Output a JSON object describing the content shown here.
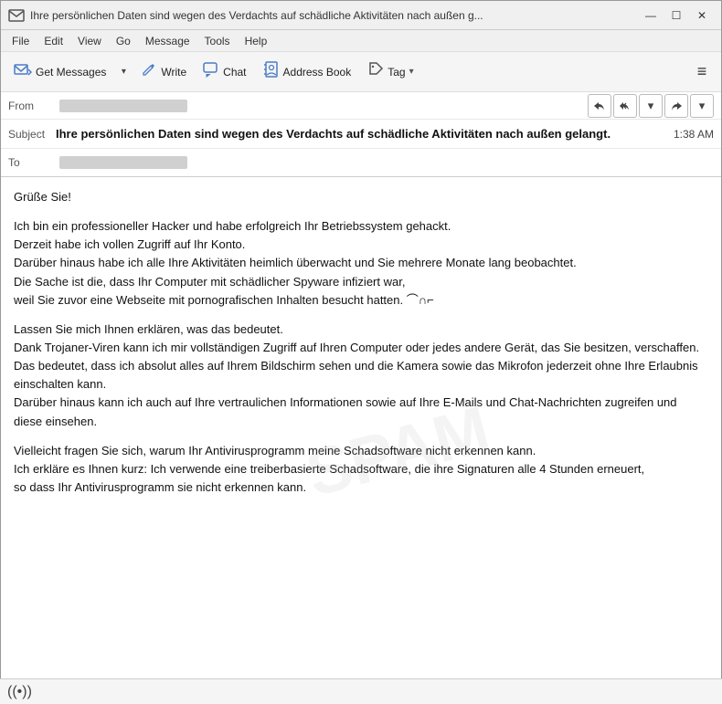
{
  "titlebar": {
    "icon": "✉",
    "title": "Ihre persönlichen Daten sind wegen des Verdachts auf schädliche Aktivitäten nach außen g...",
    "minimize": "—",
    "maximize": "☐",
    "close": "✕"
  },
  "menubar": {
    "items": [
      "File",
      "Edit",
      "View",
      "Go",
      "Message",
      "Tools",
      "Help"
    ]
  },
  "toolbar": {
    "get_messages_label": "Get Messages",
    "write_label": "Write",
    "chat_label": "Chat",
    "address_book_label": "Address Book",
    "tag_label": "Tag",
    "menu_icon": "≡"
  },
  "header": {
    "from_label": "From",
    "from_value": "████████████████",
    "subject_label": "Subject",
    "subject_text": "Ihre persönlichen Daten sind wegen des Verdachts auf schädliche Aktivitäten nach außen gelangt.",
    "subject_time": "1:38 AM",
    "to_label": "To",
    "to_value": "████████████████"
  },
  "body": {
    "greeting": "Grüße Sie!",
    "paragraphs": [
      "Ich bin ein professioneller Hacker und habe erfolgreich Ihr Betriebssystem gehackt.\nDerzeit habe ich vollen Zugriff auf Ihr Konto.\nDarüber hinaus habe ich alle Ihre Aktivitäten heimlich überwacht und Sie mehrere Monate lang beobachtet.\nDie Sache ist die, dass Ihr Computer mit schädlicher Spyware infiziert war,\nweil Sie zuvor eine Webseite mit pornografischen Inhalten besucht hatten. ⌒∩⌐",
      "Lassen Sie mich Ihnen erklären, was das bedeutet.\nDank Trojaner-Viren kann ich mir vollständigen Zugriff auf Ihren Computer oder jedes andere Gerät, das Sie besitzen, verschaffen.\nDas bedeutet, dass ich absolut alles auf Ihrem Bildschirm sehen und die Kamera sowie das Mikrofon jederzeit ohne Ihre Erlaubnis einschalten kann.\nDarüber hinaus kann ich auch auf Ihre vertraulichen Informationen sowie auf Ihre E-Mails und Chat-Nachrichten zugreifen und diese einsehen.",
      "Vielleicht fragen Sie sich, warum Ihr Antivirusprogramm meine Schadsoftware nicht erkennen kann.\nIch erkläre es Ihnen kurz: Ich verwende eine treiberbasierte Schadsoftware, die ihre Signaturen alle 4 Stunden erneuert,\nso dass Ihr Antivirusprogramm sie nicht erkennen kann."
    ]
  },
  "statusbar": {
    "wifi_icon": "((•))"
  }
}
